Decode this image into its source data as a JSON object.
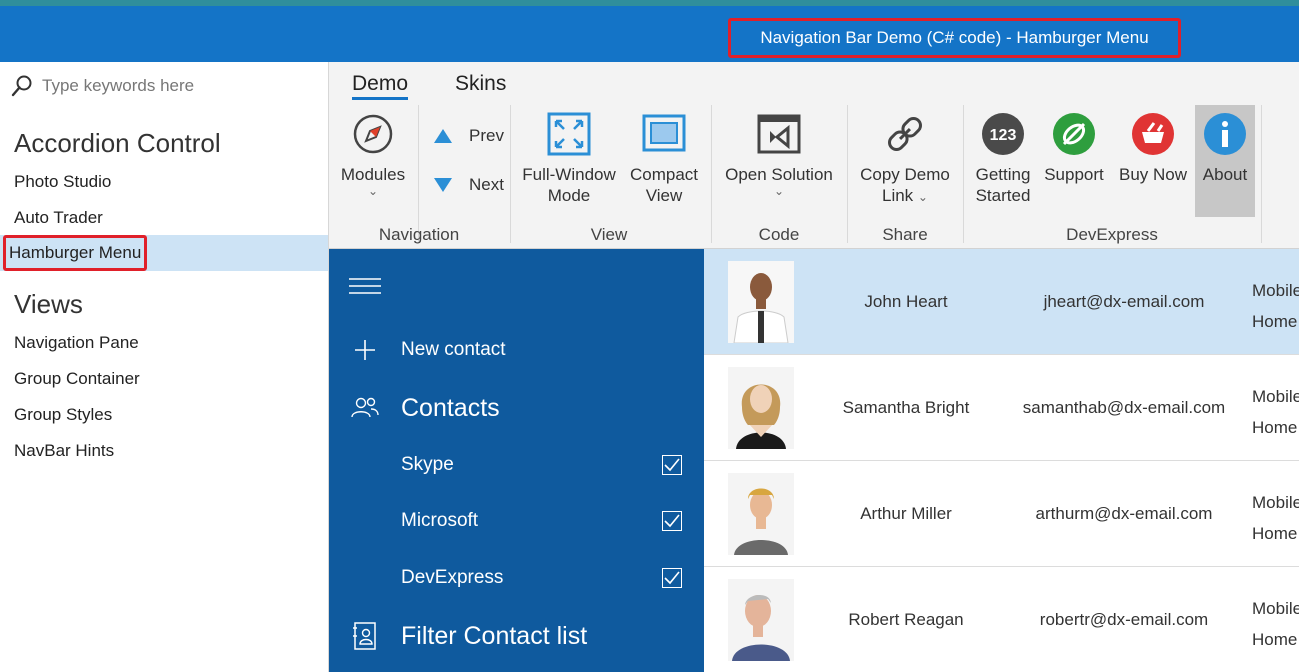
{
  "window": {
    "title": "Navigation Bar Demo (C# code) - Hamburger Menu"
  },
  "sidebar": {
    "search_placeholder": "Type keywords here",
    "groups": [
      {
        "header": "Accordion Control",
        "items": [
          "Photo Studio",
          "Auto Trader",
          "Hamburger Menu"
        ]
      },
      {
        "header": "Views",
        "items": [
          "Navigation Pane",
          "Group Container",
          "Group Styles",
          "NavBar Hints"
        ]
      }
    ],
    "selected_item": "Hamburger Menu"
  },
  "ribbon": {
    "tabs": [
      "Demo",
      "Skins"
    ],
    "active_tab": "Demo",
    "modules_label": "Modules",
    "prev_label": "Prev",
    "next_label": "Next",
    "fullwindow_label_1": "Full-Window",
    "fullwindow_label_2": "Mode",
    "compact_label_1": "Compact",
    "compact_label_2": "View",
    "open_solution_label": "Open Solution",
    "copy_link_label_1": "Copy Demo",
    "copy_link_label_2": "Link",
    "getting_started_label_1": "Getting",
    "getting_started_label_2": "Started",
    "getting_started_badge": "123",
    "support_label": "Support",
    "buy_now_label": "Buy Now",
    "about_label": "About",
    "group_labels": {
      "navigation": "Navigation",
      "view": "View",
      "code": "Code",
      "share": "Share",
      "devexpress": "DevExpress"
    },
    "colors": {
      "support": "#2e9e3e",
      "buy_now": "#e03434",
      "about": "#2b8fd6",
      "getting_started": "#4a4a4a",
      "accent": "#1474c7"
    }
  },
  "hamburger": {
    "new_contact": "New contact",
    "contacts": "Contacts",
    "filters": [
      {
        "label": "Skype",
        "checked": true
      },
      {
        "label": "Microsoft",
        "checked": true
      },
      {
        "label": "DevExpress",
        "checked": true
      }
    ],
    "filter_list": "Filter Contact list"
  },
  "contacts": [
    {
      "name": "John Heart",
      "email": "jheart@dx-email.com",
      "phone_1": "Mobile",
      "phone_2": "Home"
    },
    {
      "name": "Samantha Bright",
      "email": "samanthab@dx-email.com",
      "phone_1": "Mobile",
      "phone_2": "Home"
    },
    {
      "name": "Arthur Miller",
      "email": "arthurm@dx-email.com",
      "phone_1": "Mobile",
      "phone_2": "Home"
    },
    {
      "name": "Robert Reagan",
      "email": "robertr@dx-email.com",
      "phone_1": "Mobile",
      "phone_2": "Home"
    }
  ]
}
